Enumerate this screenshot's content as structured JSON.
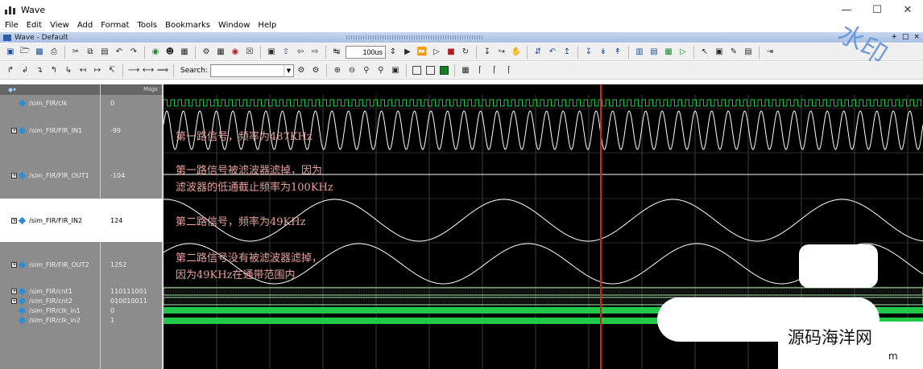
{
  "window": {
    "title": "Wave",
    "controls": [
      "—",
      "☐",
      "✕"
    ]
  },
  "menu": [
    "File",
    "Edit",
    "View",
    "Add",
    "Format",
    "Tools",
    "Bookmarks",
    "Window",
    "Help"
  ],
  "subwindow": {
    "title": "Wave - Default",
    "controls": [
      "+",
      "□",
      "×"
    ]
  },
  "toolbar": {
    "time_value": "100us",
    "search_label": "Search:",
    "search_value": ""
  },
  "panes": {
    "msgs_header": "Msgs"
  },
  "signals": [
    {
      "name": "/sim_FIR/clk",
      "value": "0",
      "expandable": false,
      "highlight": false
    },
    {
      "name": "/sim_FIR/FIR_IN1",
      "value": "-99",
      "expandable": true,
      "highlight": false
    },
    {
      "name": "/sim_FIR/FIR_OUT1",
      "value": "-104",
      "expandable": true,
      "highlight": false
    },
    {
      "name": "/sim_FIR/FIR_IN2",
      "value": "124",
      "expandable": true,
      "highlight": true
    },
    {
      "name": "/sim_FIR/FIR_OUT2",
      "value": "1252",
      "expandable": true,
      "highlight": false
    },
    {
      "name": "/sim_FIR/cnt1",
      "value": "110111001",
      "expandable": true,
      "highlight": false
    },
    {
      "name": "/sim_FIR/cnt2",
      "value": "010010011",
      "expandable": true,
      "highlight": false
    },
    {
      "name": "/sim_FIR/clk_in1",
      "value": "0",
      "expandable": false,
      "highlight": false
    },
    {
      "name": "/sim_FIR/clk_in2",
      "value": "1",
      "expandable": false,
      "highlight": false
    }
  ],
  "annotations": {
    "in1": "第一路信号，频率为487KHz",
    "out1_line1": "第一路信号被滤波器滤掉，因为",
    "out1_line2": "滤波器的低通截止频率为100KHz",
    "in2": "第二路信号，频率为49KHz",
    "out2_line1": "第二路信号没有被滤波器滤掉，",
    "out2_line2": "因为49KHz在通带范围内"
  },
  "watermarks": {
    "site": "源码海洋网",
    "site_suffix": "m",
    "stamp": "水印"
  },
  "colors": {
    "wave_bg": "#000000",
    "wave_trace": "#ffffff",
    "clock_trace": "#21c94a",
    "bus_trace": "#b6f5b6",
    "cursor": "#d42020",
    "annotation": "#e8a09b"
  }
}
